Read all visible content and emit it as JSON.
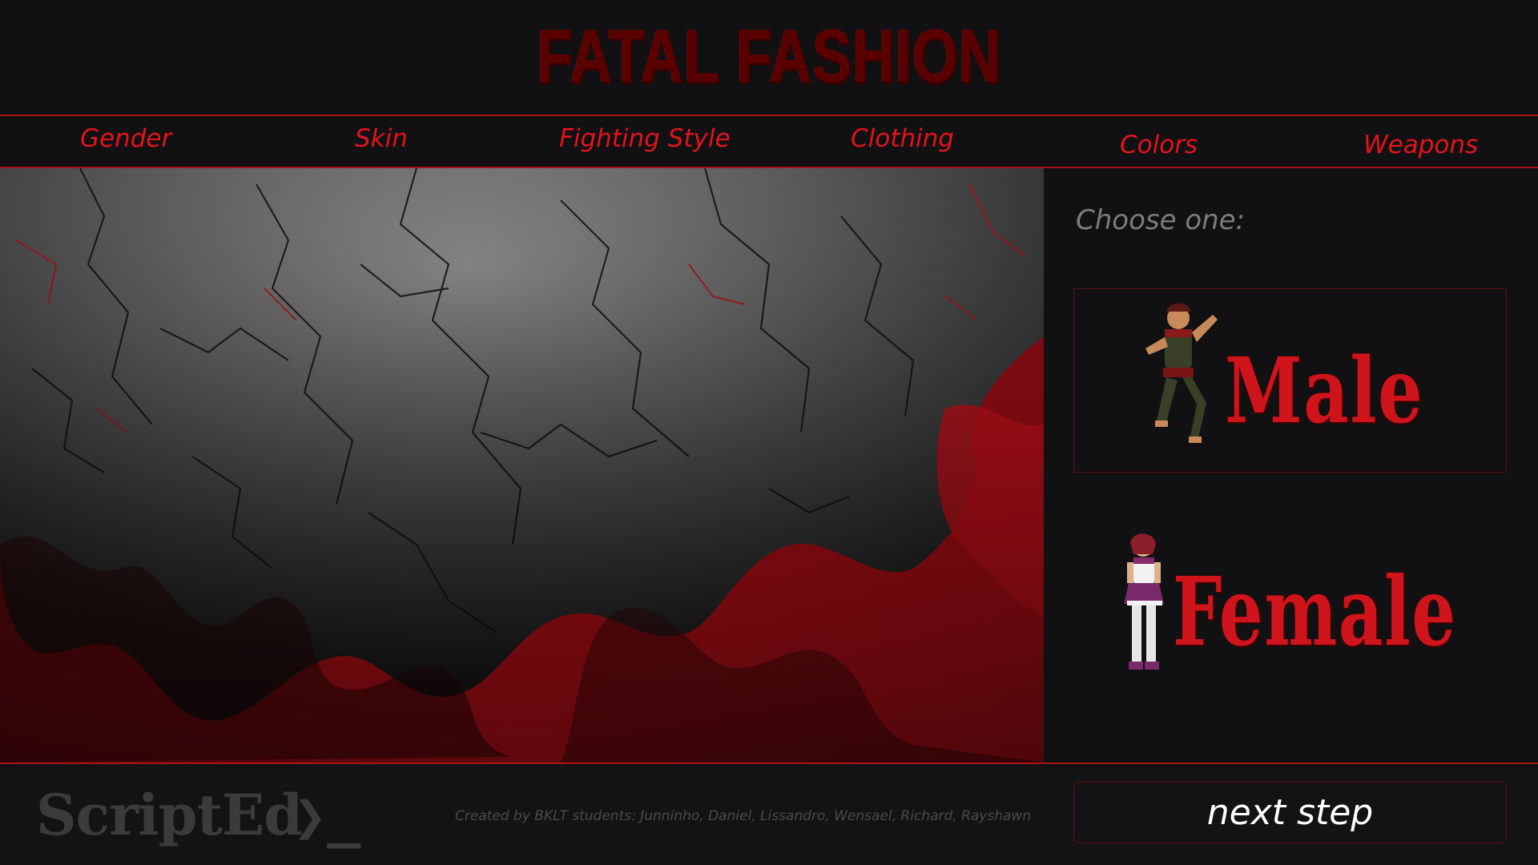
{
  "header": {
    "logo_text": "FATAL FASHION"
  },
  "nav": {
    "items": [
      {
        "label": "Gender"
      },
      {
        "label": "Skin"
      },
      {
        "label": "Fighting Style"
      },
      {
        "label": "Clothing"
      },
      {
        "label": "Colors"
      },
      {
        "label": "Weapons"
      }
    ]
  },
  "panel": {
    "prompt": "Choose one:",
    "options": [
      {
        "label": "Male",
        "icon": "male-fighter-sprite"
      },
      {
        "label": "Female",
        "icon": "female-fighter-sprite"
      }
    ]
  },
  "footer": {
    "brand": "ScriptEd",
    "brand_mark": "❯_",
    "credits": "Created by BKLT students: Junninho, Daniel, Lissandro, Wensael, Richard, Rayshawn",
    "next_label": "next step"
  },
  "colors": {
    "accent_red": "#d1141b",
    "background": "#111113",
    "muted_text": "#7c7c7c"
  }
}
